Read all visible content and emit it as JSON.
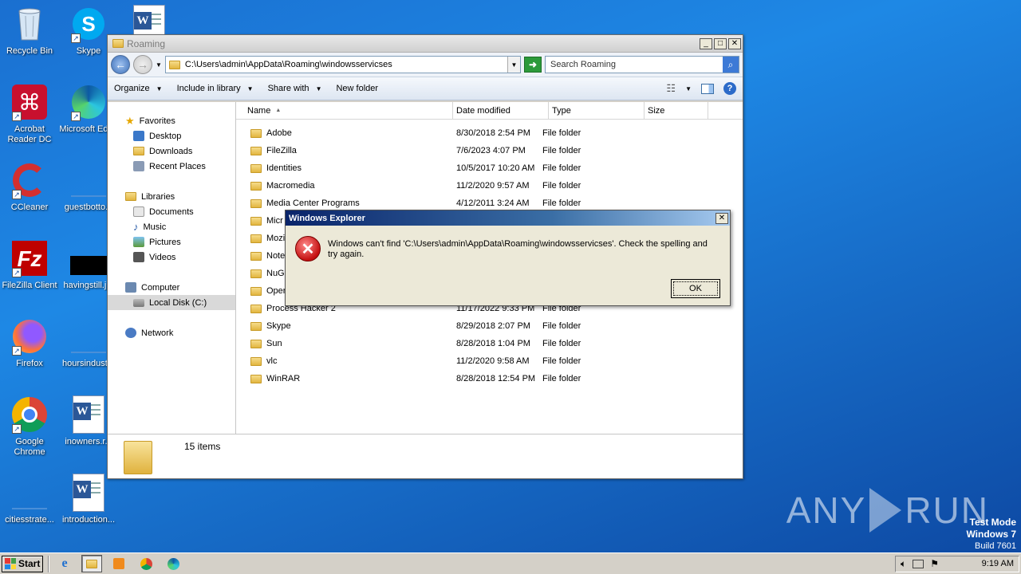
{
  "desktop": {
    "icons": [
      {
        "label": "Recycle Bin"
      },
      {
        "label": "Skype"
      },
      {
        "label": "Acrobat Reader DC"
      },
      {
        "label": "Microsoft Edge"
      },
      {
        "label": "CCleaner"
      },
      {
        "label": "guestbotto..."
      },
      {
        "label": "FileZilla Client"
      },
      {
        "label": "havingstill.j..."
      },
      {
        "label": "Firefox"
      },
      {
        "label": "hoursindust..."
      },
      {
        "label": "Google Chrome"
      },
      {
        "label": "inowners.r..."
      },
      {
        "label": "citiesstrate..."
      },
      {
        "label": "introduction..."
      }
    ]
  },
  "explorer": {
    "title": "Roaming",
    "address": "C:\\Users\\admin\\AppData\\Roaming\\windowsservicses",
    "search_placeholder": "Search Roaming",
    "toolbar": {
      "organize": "Organize",
      "include_in_library": "Include in library",
      "share_with": "Share with",
      "new_folder": "New folder"
    },
    "nav": {
      "favorites": "Favorites",
      "desktop": "Desktop",
      "downloads": "Downloads",
      "recent_places": "Recent Places",
      "libraries": "Libraries",
      "documents": "Documents",
      "music": "Music",
      "pictures": "Pictures",
      "videos": "Videos",
      "computer": "Computer",
      "local_disk": "Local Disk (C:)",
      "network": "Network"
    },
    "columns": {
      "name": "Name",
      "date": "Date modified",
      "type": "Type",
      "size": "Size"
    },
    "files": [
      {
        "name": "Adobe",
        "date": "8/30/2018 2:54 PM",
        "type": "File folder"
      },
      {
        "name": "FileZilla",
        "date": "7/6/2023 4:07 PM",
        "type": "File folder"
      },
      {
        "name": "Identities",
        "date": "10/5/2017 10:20 AM",
        "type": "File folder"
      },
      {
        "name": "Macromedia",
        "date": "11/2/2020 9:57 AM",
        "type": "File folder"
      },
      {
        "name": "Media Center Programs",
        "date": "4/12/2011 3:24 AM",
        "type": "File folder"
      },
      {
        "name": "Micr",
        "date": "",
        "type": ""
      },
      {
        "name": "Mozil",
        "date": "",
        "type": ""
      },
      {
        "name": "Note",
        "date": "",
        "type": ""
      },
      {
        "name": "NuGe",
        "date": "",
        "type": ""
      },
      {
        "name": "Oper",
        "date": "",
        "type": ""
      },
      {
        "name": "Process Hacker 2",
        "date": "11/17/2022 9:33 PM",
        "type": "File folder"
      },
      {
        "name": "Skype",
        "date": "8/29/2018 2:07 PM",
        "type": "File folder"
      },
      {
        "name": "Sun",
        "date": "8/28/2018 1:04 PM",
        "type": "File folder"
      },
      {
        "name": "vlc",
        "date": "11/2/2020 9:58 AM",
        "type": "File folder"
      },
      {
        "name": "WinRAR",
        "date": "8/28/2018 12:54 PM",
        "type": "File folder"
      }
    ],
    "status": "15 items"
  },
  "dialog": {
    "title": "Windows Explorer",
    "message": "Windows can't find 'C:\\Users\\admin\\AppData\\Roaming\\windowsservicses'.  Check the spelling and try again.",
    "ok": "OK"
  },
  "watermark": {
    "text_left": "ANY",
    "text_right": "RUN"
  },
  "test_mode": {
    "line1": "Test Mode",
    "line2": "Windows 7",
    "line3": "Build 7601"
  },
  "taskbar": {
    "start": "Start",
    "clock": "9:19 AM"
  }
}
